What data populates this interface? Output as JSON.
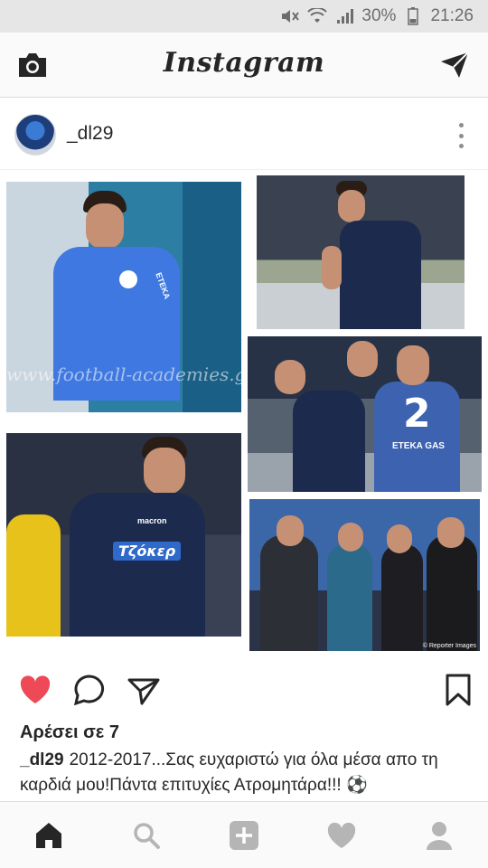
{
  "status_bar": {
    "battery_percent": "30%",
    "time": "21:26",
    "icons": [
      "mute-icon",
      "wifi-icon",
      "signal-icon",
      "battery-icon"
    ]
  },
  "header": {
    "title": "Instagram",
    "left_icon": "camera-icon",
    "right_icon": "direct-message-icon"
  },
  "post": {
    "username": "_dl29",
    "avatar_icon": "avatar",
    "more_icon": "more-options-icon",
    "collage": {
      "watermark": "www.football-academies.gr",
      "photo_credit": "© Reporter Images",
      "sponsor_text": "Τζόκερ",
      "kit_brand": "macron",
      "shirt_brand": "ETEKA",
      "shirt_number": "2",
      "gas_label": "ETEKA GAS"
    },
    "likes_text": "Αρέσει σε 7",
    "caption_user": "_dl29",
    "caption_text": "2012-2017...Σας ευχαριστώ για όλα μέσα απο τη καρδιά μου!Πάντα επιτυχίες Ατρομητάρα!!! ⚽",
    "liked": true,
    "colors": {
      "like": "#ed4956",
      "text": "#262626",
      "muted": "#8e8e8e"
    }
  },
  "bottom_nav": {
    "items": [
      "home-icon",
      "search-icon",
      "add-post-icon",
      "activity-heart-icon",
      "profile-icon"
    ]
  }
}
